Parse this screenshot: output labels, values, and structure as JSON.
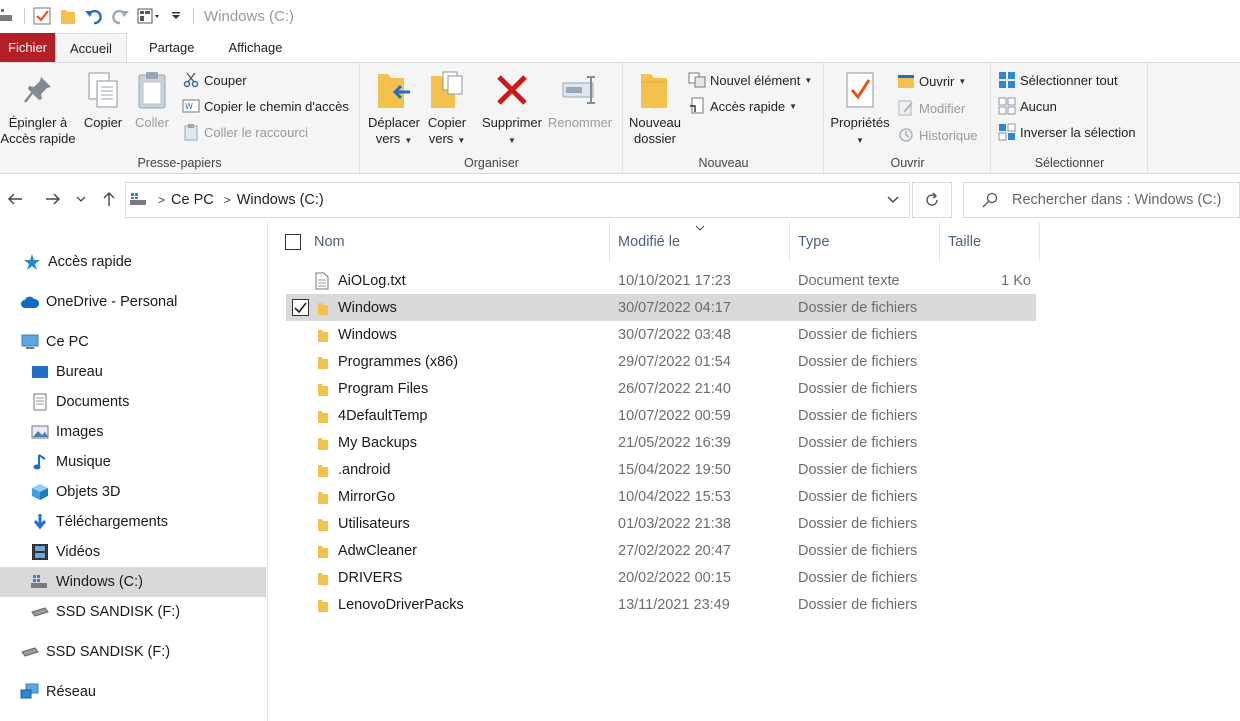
{
  "window": {
    "title": "Windows (C:)"
  },
  "tabs": [
    {
      "label": "Fichier"
    },
    {
      "label": "Accueil"
    },
    {
      "label": "Partage"
    },
    {
      "label": "Affichage"
    }
  ],
  "ribbon": {
    "clipboard": {
      "label": "Presse-papiers",
      "pin_line1": "Épingler à",
      "pin_line2": "Accès rapide",
      "copy": "Copier",
      "paste": "Coller",
      "cut": "Couper",
      "copy_path": "Copier le chemin d'accès",
      "paste_shortcut": "Coller le raccourci"
    },
    "organize": {
      "label": "Organiser",
      "move_line1": "Déplacer",
      "move_line2": "vers",
      "copyto_line1": "Copier",
      "copyto_line2": "vers",
      "delete": "Supprimer",
      "rename": "Renommer"
    },
    "new": {
      "label": "Nouveau",
      "newfolder_line1": "Nouveau",
      "newfolder_line2": "dossier",
      "new_item": "Nouvel élément",
      "easy_access": "Accès rapide"
    },
    "open": {
      "label": "Ouvrir",
      "properties": "Propriétés",
      "open": "Ouvrir",
      "edit": "Modifier",
      "history": "Historique"
    },
    "select": {
      "label": "Sélectionner",
      "select_all": "Sélectionner tout",
      "select_none": "Aucun",
      "invert": "Inverser la sélection"
    }
  },
  "address": {
    "crumbs": [
      "Ce PC",
      "Windows (C:)"
    ],
    "search_placeholder": "Rechercher dans : Windows (C:)"
  },
  "nav": [
    {
      "label": "Accès rapide"
    },
    {
      "label": "OneDrive - Personal"
    },
    {
      "label": "Ce PC"
    },
    {
      "label": "Bureau"
    },
    {
      "label": "Documents"
    },
    {
      "label": "Images"
    },
    {
      "label": "Musique"
    },
    {
      "label": "Objets 3D"
    },
    {
      "label": "Téléchargements"
    },
    {
      "label": "Vidéos"
    },
    {
      "label": "Windows (C:)"
    },
    {
      "label": "SSD SANDISK (F:)"
    },
    {
      "label": "SSD SANDISK (F:)"
    },
    {
      "label": "Réseau"
    }
  ],
  "columns": {
    "name": "Nom",
    "modified": "Modifié le",
    "type": "Type",
    "size": "Taille"
  },
  "files": [
    {
      "name": "AiOLog.txt",
      "modified": "10/10/2021 17:23",
      "type": "Document texte",
      "size": "1 Ko"
    },
    {
      "name": "Windows",
      "modified": "30/07/2022 04:17",
      "type": "Dossier de fichiers",
      "size": ""
    },
    {
      "name": "Windows",
      "modified": "30/07/2022 03:48",
      "type": "Dossier de fichiers",
      "size": ""
    },
    {
      "name": "Programmes (x86)",
      "modified": "29/07/2022 01:54",
      "type": "Dossier de fichiers",
      "size": ""
    },
    {
      "name": "Program Files",
      "modified": "26/07/2022 21:40",
      "type": "Dossier de fichiers",
      "size": ""
    },
    {
      "name": "4DefaultTemp",
      "modified": "10/07/2022 00:59",
      "type": "Dossier de fichiers",
      "size": ""
    },
    {
      "name": "My Backups",
      "modified": "21/05/2022 16:39",
      "type": "Dossier de fichiers",
      "size": ""
    },
    {
      "name": ".android",
      "modified": "15/04/2022 19:50",
      "type": "Dossier de fichiers",
      "size": ""
    },
    {
      "name": "MirrorGo",
      "modified": "10/04/2022 15:53",
      "type": "Dossier de fichiers",
      "size": ""
    },
    {
      "name": "Utilisateurs",
      "modified": "01/03/2022 21:38",
      "type": "Dossier de fichiers",
      "size": ""
    },
    {
      "name": "AdwCleaner",
      "modified": "27/02/2022 20:47",
      "type": "Dossier de fichiers",
      "size": ""
    },
    {
      "name": "DRIVERS",
      "modified": "20/02/2022 00:15",
      "type": "Dossier de fichiers",
      "size": ""
    },
    {
      "name": "LenovoDriverPacks",
      "modified": "13/11/2021 23:49",
      "type": "Dossier de fichiers",
      "size": ""
    }
  ],
  "colors": {
    "file_tab": "#b41f27",
    "folder": "#f3c24c",
    "selection": "#d9d9d9",
    "header_text": "#4c607a"
  }
}
